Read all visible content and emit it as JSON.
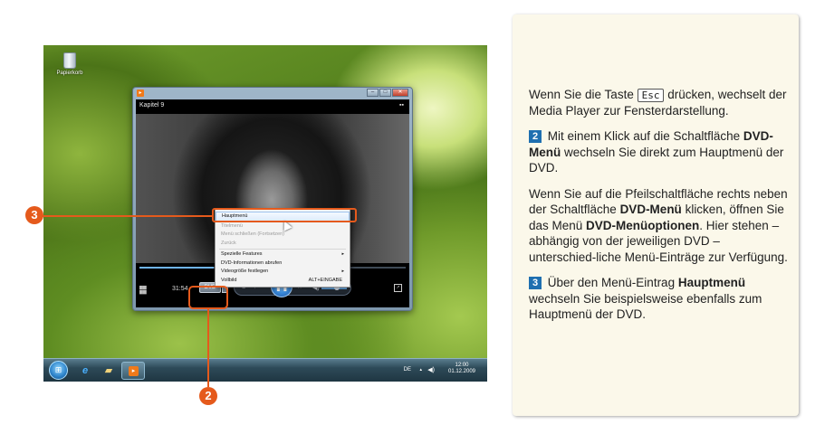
{
  "screenshot": {
    "recycle_bin_label": "Papierkorb",
    "player": {
      "chapter_title": "Kapitel 9",
      "time": "31:54",
      "dvd_button_label": "DVD",
      "seek_progress_fraction": 0.28,
      "context_menu": {
        "items": [
          {
            "label": "Hauptmenü",
            "state": "highlighted"
          },
          {
            "label": "Titelmenü",
            "state": "disabled"
          },
          {
            "label": "Menü schließen (Fortsetzen)",
            "state": "disabled"
          },
          {
            "label": "Zurück",
            "state": "disabled"
          },
          {
            "label": "Spezielle Features",
            "state": "submenu"
          },
          {
            "label": "DVD-Informationen abrufen",
            "state": "normal"
          },
          {
            "label": "Videogröße festlegen",
            "state": "submenu"
          },
          {
            "label": "Vollbild",
            "state": "normal",
            "shortcut": "ALT+EINGABE"
          }
        ]
      }
    },
    "taskbar": {
      "language": "DE",
      "clock_time": "12:00",
      "clock_date": "01.12.2009"
    }
  },
  "callouts": {
    "callout_2": "2",
    "callout_3": "3"
  },
  "instructions": {
    "p1_before": "Wenn Sie die Taste ",
    "p1_key": "Esc",
    "p1_after": " drücken, wechselt der Media Player zur Fensterdarstellung.",
    "p2_num": "2",
    "p2_before": " Mit einem Klick auf die Schaltfläche ",
    "p2_bold": "DVD-Menü",
    "p2_after": " wechseln Sie direkt zum Hauptmenü der DVD.",
    "p3_before": "Wenn Sie auf die Pfeilschaltfläche rechts neben der Schaltfläche ",
    "p3_bold1": "DVD-Menü",
    "p3_mid": " klicken, öffnen Sie das Menü ",
    "p3_bold2": "DVD-Menüoptionen",
    "p3_after": ". Hier stehen – abhängig von der jeweiligen DVD – unterschied-liche Menü-Einträge zur Verfügung.",
    "p4_num": "3",
    "p4_before": " Über den Menü-Eintrag ",
    "p4_bold": "Hauptmenü",
    "p4_after": " wechseln Sie beispielsweise ebenfalls zum Hauptmenü der DVD."
  },
  "colors": {
    "callout_orange": "#e55a1c",
    "step_blue": "#1f6fb0",
    "card_background": "#fbf8ea"
  }
}
